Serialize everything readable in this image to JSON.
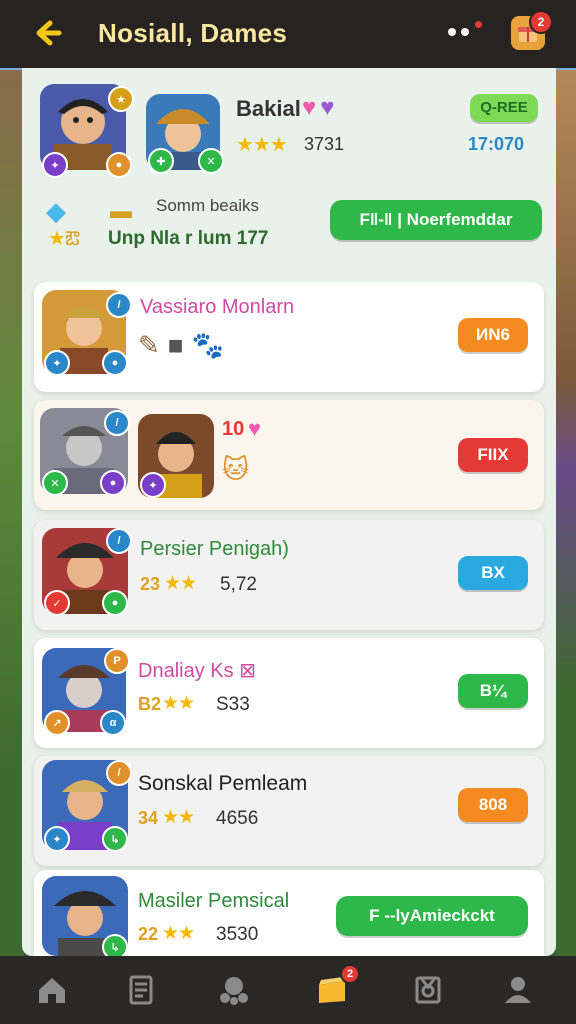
{
  "topbar": {
    "title": "Nosiall, Dames",
    "icons": [
      "back-arrow-icon",
      "more-dots-icon",
      "gift-icon"
    ],
    "gift_badge": "2"
  },
  "header": {
    "name": "Bakial",
    "rating": "3731",
    "status_badge": "Q-REE",
    "status_value": "17:070",
    "reward_label": "Somm beaiks",
    "reward_sub": "Unp Nla r lum 177",
    "cta_label": "F‖-‖ | Noerfemddar"
  },
  "cards": [
    {
      "name": "Vassiaro Monlarn",
      "badge": "ИN6",
      "badge_color": "#f58a1f",
      "name_color": "#d04aa0",
      "items": [
        "torch-icon",
        "stone-icon",
        "creature-icon"
      ]
    },
    {
      "name": "10",
      "badge": "FIIX",
      "badge_color": "#e53935",
      "name_color": "#e53935",
      "items": [
        "cat-icon"
      ]
    },
    {
      "name": "Persier Penigah)",
      "sub": "23",
      "rating": "5,72",
      "badge": "BX",
      "badge_color": "#2aa8e0",
      "name_color": "#2e8b3a"
    },
    {
      "name": "Dnaliay Ks ⊠",
      "sub": "B2",
      "rating": "S33",
      "badge": "B¼",
      "badge_color": "#2eb84a",
      "name_color": "#d04aa0"
    },
    {
      "name": "Sonskal Pemleam",
      "sub": "34",
      "rating": "4656",
      "badge": "808",
      "badge_color": "#f58a1f",
      "name_color": "#222222"
    },
    {
      "name": "Masiler Pemsical",
      "sub": "22",
      "rating": "3530",
      "badge": "F --lyAmieckckt",
      "badge_color": "#2eb84a",
      "name_color": "#2e8b3a"
    }
  ],
  "nav": {
    "items": [
      "home-icon",
      "cards-icon",
      "guild-icon",
      "chest-icon",
      "quest-icon",
      "profile-icon"
    ],
    "active_badge": "2"
  }
}
